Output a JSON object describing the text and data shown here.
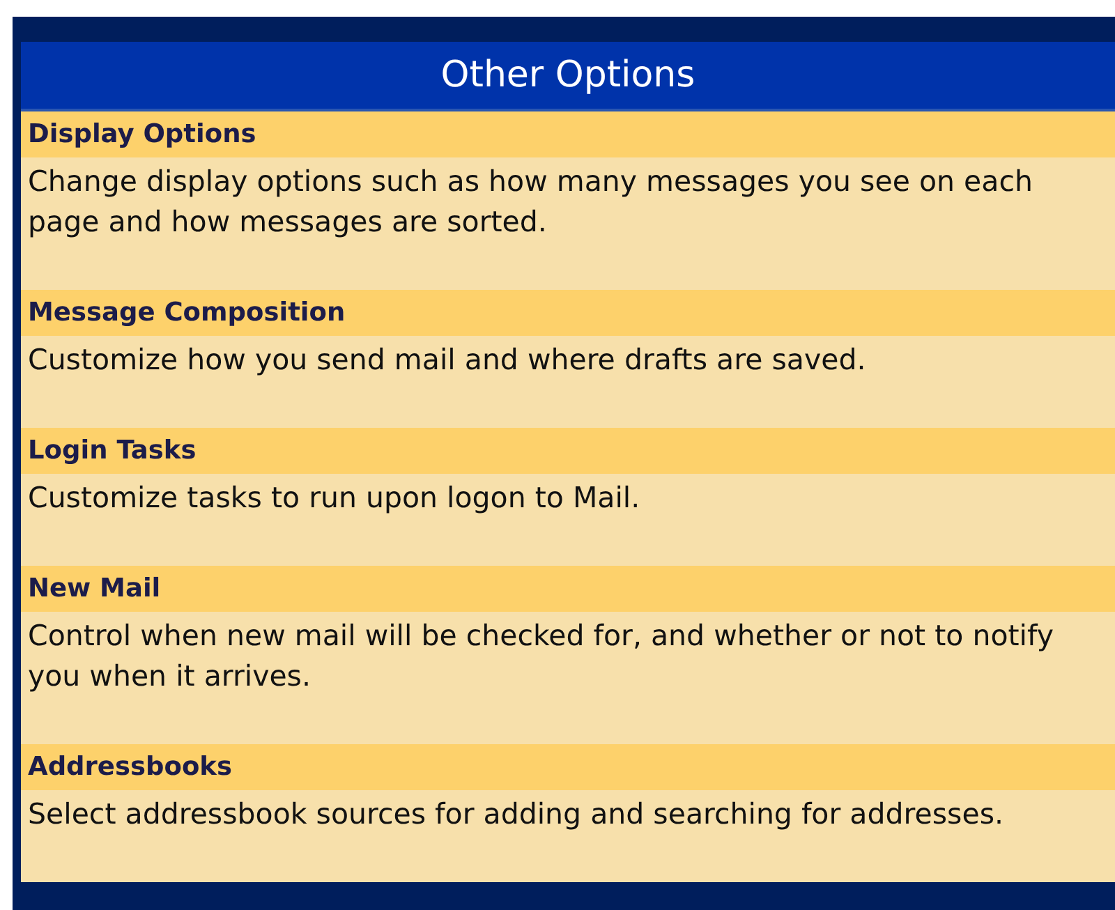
{
  "title": "Other Options",
  "sections": [
    {
      "heading": "Display Options",
      "description": "Change display options such as how many messages you see on each page and how messages are sorted."
    },
    {
      "heading": "Message Composition",
      "description": "Customize how you send mail and where drafts are saved."
    },
    {
      "heading": "Login Tasks",
      "description": "Customize tasks to run upon logon to Mail."
    },
    {
      "heading": "New Mail",
      "description": "Control when new mail will be checked for, and whether or not to notify you when it arrives."
    },
    {
      "heading": "Addressbooks",
      "description": "Select addressbook sources for adding and searching for addresses."
    }
  ]
}
